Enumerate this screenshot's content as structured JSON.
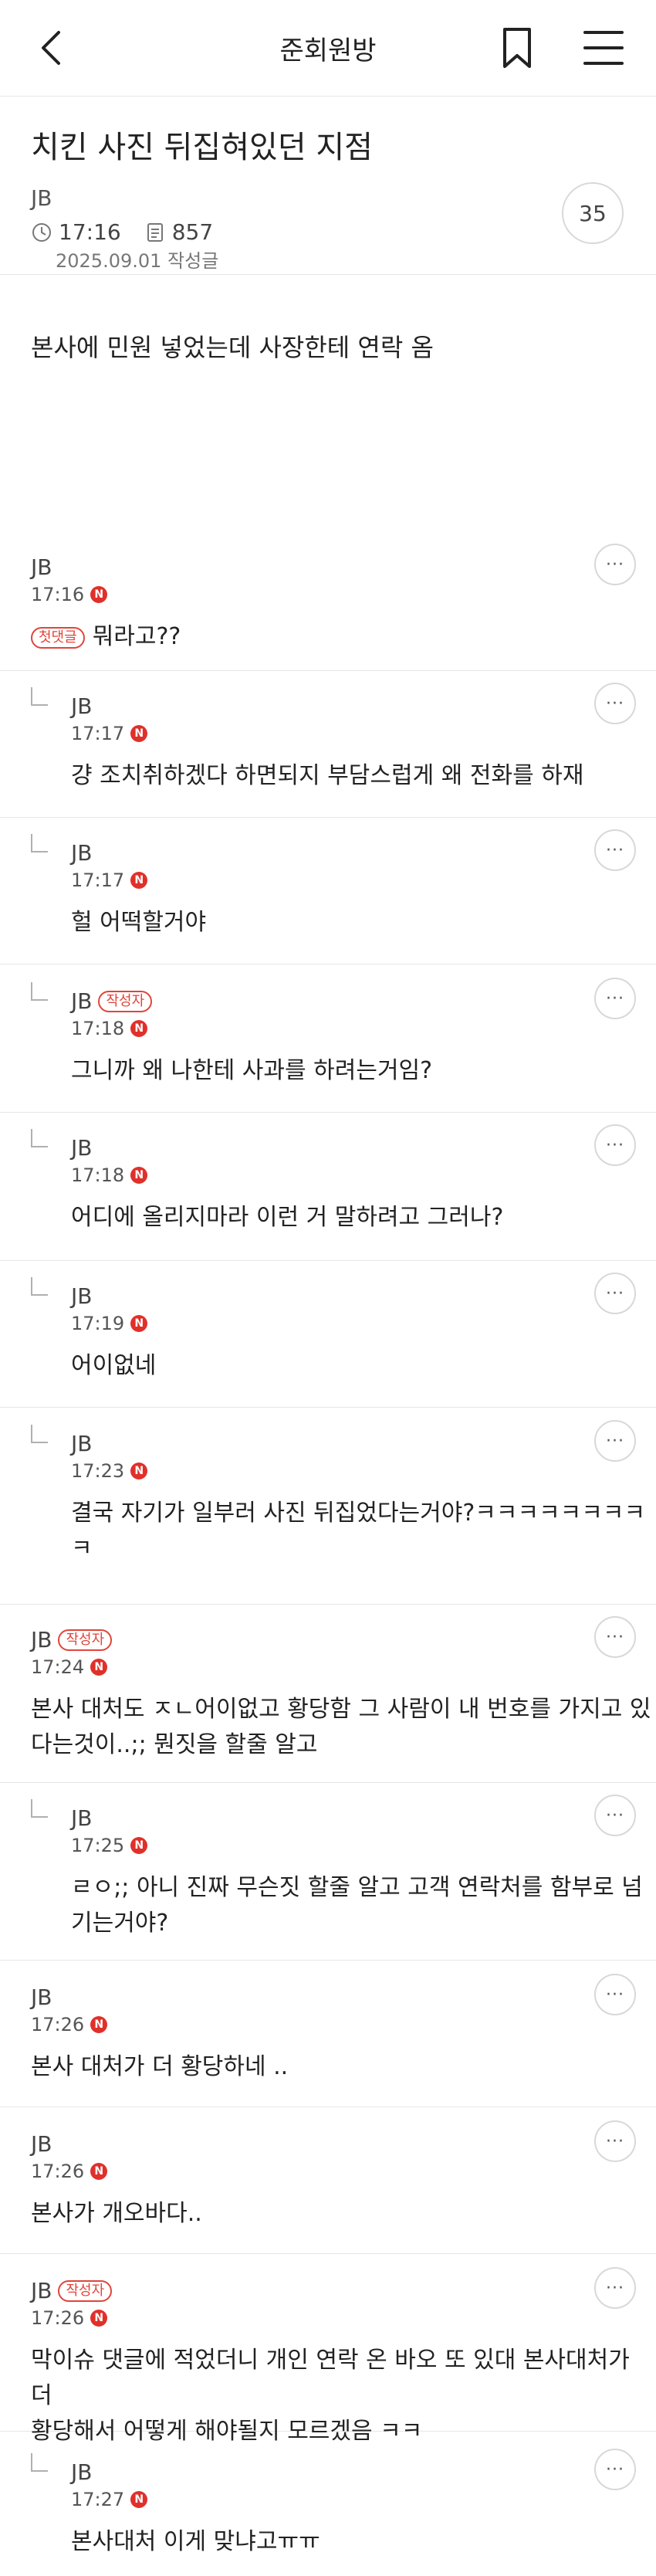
{
  "header": {
    "board_name": "준회원방"
  },
  "post": {
    "title": "치킨 사진 뒤집혀있던 지점",
    "author": "JB",
    "time": "17:16",
    "views": "857",
    "date_label": "2025.09.01 작성글",
    "comment_count": "35",
    "body": "본사에 민원 넣었는데 사장한테 연락 옴"
  },
  "labels": {
    "new_badge": "N",
    "author_badge": "작성자",
    "first_comment_badge": "첫댓글",
    "more": "···"
  },
  "comments": [
    {
      "author": "JB",
      "time": "17:16",
      "text": "뭐라고??",
      "reply": false,
      "is_author": false,
      "first": true
    },
    {
      "author": "JB",
      "time": "17:17",
      "text": "걍 조치취하겠다 하면되지 부담스럽게 왜 전화를 하재",
      "reply": true,
      "is_author": false
    },
    {
      "author": "JB",
      "time": "17:17",
      "text": "헐 어떡할거야",
      "reply": true,
      "is_author": false
    },
    {
      "author": "JB",
      "time": "17:18",
      "text": "그니까 왜 나한테 사과를 하려는거임?",
      "reply": true,
      "is_author": true
    },
    {
      "author": "JB",
      "time": "17:18",
      "text": "어디에 올리지마라 이런 거 말하려고 그러나?",
      "reply": true,
      "is_author": false
    },
    {
      "author": "JB",
      "time": "17:19",
      "text": "어이없네",
      "reply": true,
      "is_author": false
    },
    {
      "author": "JB",
      "time": "17:23",
      "text_lines": [
        "결국 자기가 일부러 사진 뒤집었다는거야?ㅋㅋㅋㅋㅋㅋㅋㅋ",
        "ㅋ"
      ],
      "reply": true,
      "is_author": false
    },
    {
      "author": "JB",
      "time": "17:24",
      "text_lines": [
        "본사 대처도 ㅈㄴ어이없고 황당함 그 사람이 내 번호를 가지고 있",
        "다는것이..;; 뭔짓을 할줄 알고"
      ],
      "reply": false,
      "is_author": true
    },
    {
      "author": "JB",
      "time": "17:25",
      "text_lines": [
        "ㄹㅇ;; 아니 진짜 무슨짓 할줄 알고 고객 연락처를 함부로 넘",
        "기는거야?"
      ],
      "reply": true,
      "is_author": false
    },
    {
      "author": "JB",
      "time": "17:26",
      "text": "본사 대처가 더 황당하네 ..",
      "reply": false,
      "is_author": false
    },
    {
      "author": "JB",
      "time": "17:26",
      "text": "본사가 개오바다..",
      "reply": false,
      "is_author": false
    },
    {
      "author": "JB",
      "time": "17:26",
      "text_lines": [
        "막이슈 댓글에 적었더니 개인 연락 온 바오 또 있대 본사대처가 더",
        "황당해서 어떻게 해야될지 모르겠음 ㅋㅋ"
      ],
      "reply": false,
      "is_author": true
    },
    {
      "author": "JB",
      "time": "17:27",
      "text": "본사대처 이게 맞냐고ㅠㅠ",
      "reply": true,
      "is_author": false
    }
  ]
}
